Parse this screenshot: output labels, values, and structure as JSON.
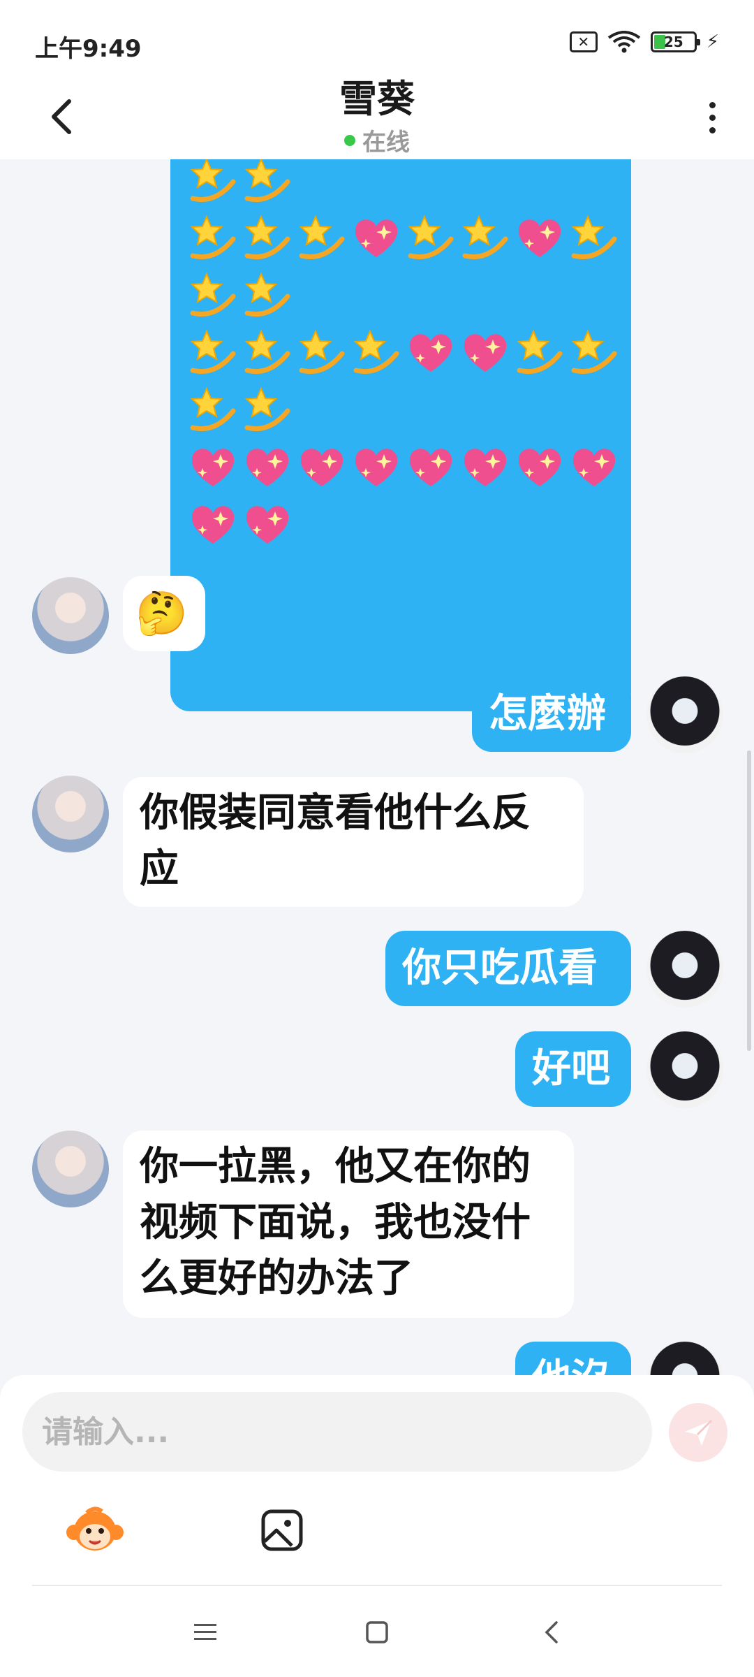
{
  "status_bar": {
    "time": "上午9:49",
    "battery": "25"
  },
  "header": {
    "title": "雪葵",
    "status": "在线"
  },
  "emoji_message": {
    "lines": [
      [
        "star",
        "star"
      ],
      [
        "star",
        "star",
        "star",
        "heart",
        "star",
        "star",
        "heart",
        "star"
      ],
      [
        "star",
        "star"
      ],
      [
        "star",
        "star",
        "star",
        "star",
        "heart",
        "heart",
        "star",
        "star"
      ],
      [
        "star",
        "star"
      ],
      [
        "heart",
        "heart",
        "heart",
        "heart",
        "heart",
        "heart",
        "heart",
        "heart"
      ],
      [
        "heart",
        "heart"
      ]
    ]
  },
  "messages": [
    {
      "from": "them",
      "text": "🤔"
    },
    {
      "from": "me",
      "text": "怎麼辦"
    },
    {
      "from": "them",
      "line1": "你假装同意看他什么反",
      "line2": "应"
    },
    {
      "from": "me",
      "text": "你只吃瓜看"
    },
    {
      "from": "me",
      "text": "好吧"
    },
    {
      "from": "them",
      "line1": "你一拉黑，他又在你的",
      "line2": "视频下面说，我也没什",
      "line3": "么更好的办法了"
    },
    {
      "from": "me",
      "text": "他沒"
    }
  ],
  "composer": {
    "placeholder": "请输入..."
  },
  "colors": {
    "accent": "#2eb2f4",
    "online": "#38c94a",
    "send": "#fbe3e3"
  },
  "icons": [
    "back-arrow-icon",
    "more-dots-icon",
    "monkey-sticker-icon",
    "image-icon",
    "send-icon",
    "menu-icon",
    "home-square-icon",
    "nav-back-icon"
  ]
}
